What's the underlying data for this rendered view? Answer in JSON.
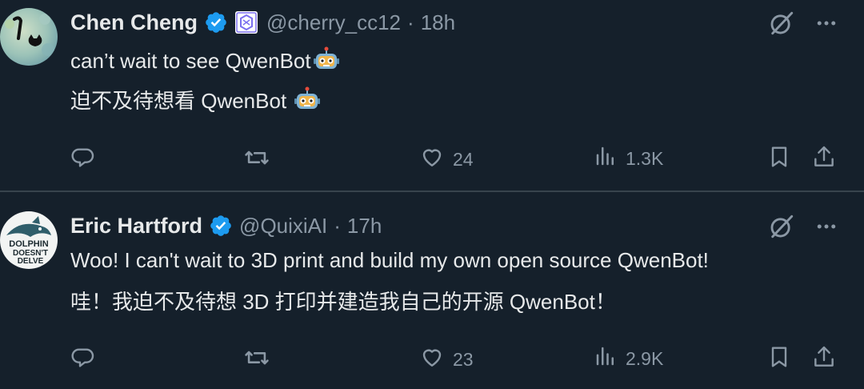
{
  "tweets": [
    {
      "name": "Chen Cheng",
      "handle": "@cherry_cc12",
      "separator": "·",
      "time": "18h",
      "line1": "can’t wait to see QwenBot",
      "line2": "迫不及待想看 QwenBot",
      "likes": "24",
      "views": "1.3K"
    },
    {
      "name": "Eric Hartford",
      "handle": "@QuixiAI",
      "separator": "·",
      "time": "17h",
      "line1": "Woo!  I can't wait to 3D print and build my own open source QwenBot!",
      "line2": "哇！我迫不及待想 3D 打印并建造我自己的开源 QwenBot！",
      "likes": "23",
      "views": "2.9K",
      "avatar_text": [
        "DOLPHIN",
        "DOESN'T",
        "DELVE"
      ]
    }
  ],
  "colors": {
    "background": "#15202b",
    "text_primary": "#e7e9ea",
    "text_secondary": "#8b98a5",
    "verified_blue": "#1d9bf0",
    "divider": "#38444d"
  },
  "icons": [
    "verified-badge-icon",
    "affiliation-badge-icon",
    "grok-icon",
    "more-icon",
    "reply-icon",
    "retweet-icon",
    "like-icon",
    "views-icon",
    "bookmark-icon",
    "share-icon",
    "robot-emoji-icon"
  ]
}
